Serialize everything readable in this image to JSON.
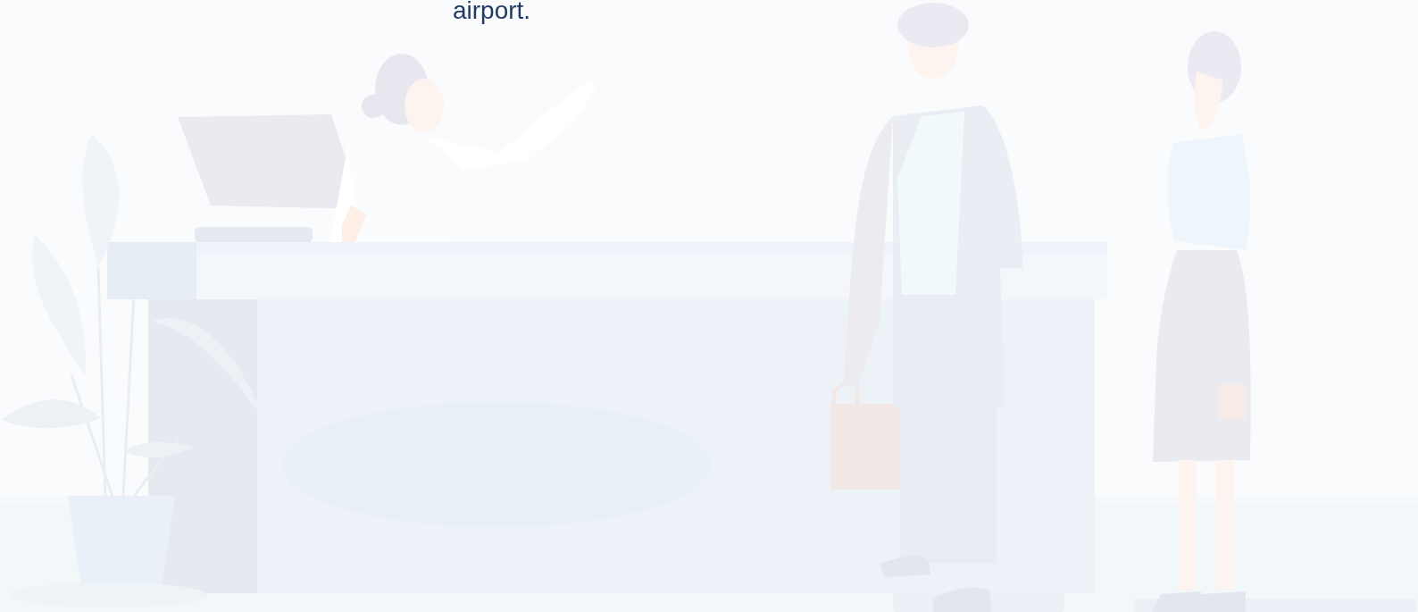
{
  "heading": {
    "text": "airport."
  }
}
